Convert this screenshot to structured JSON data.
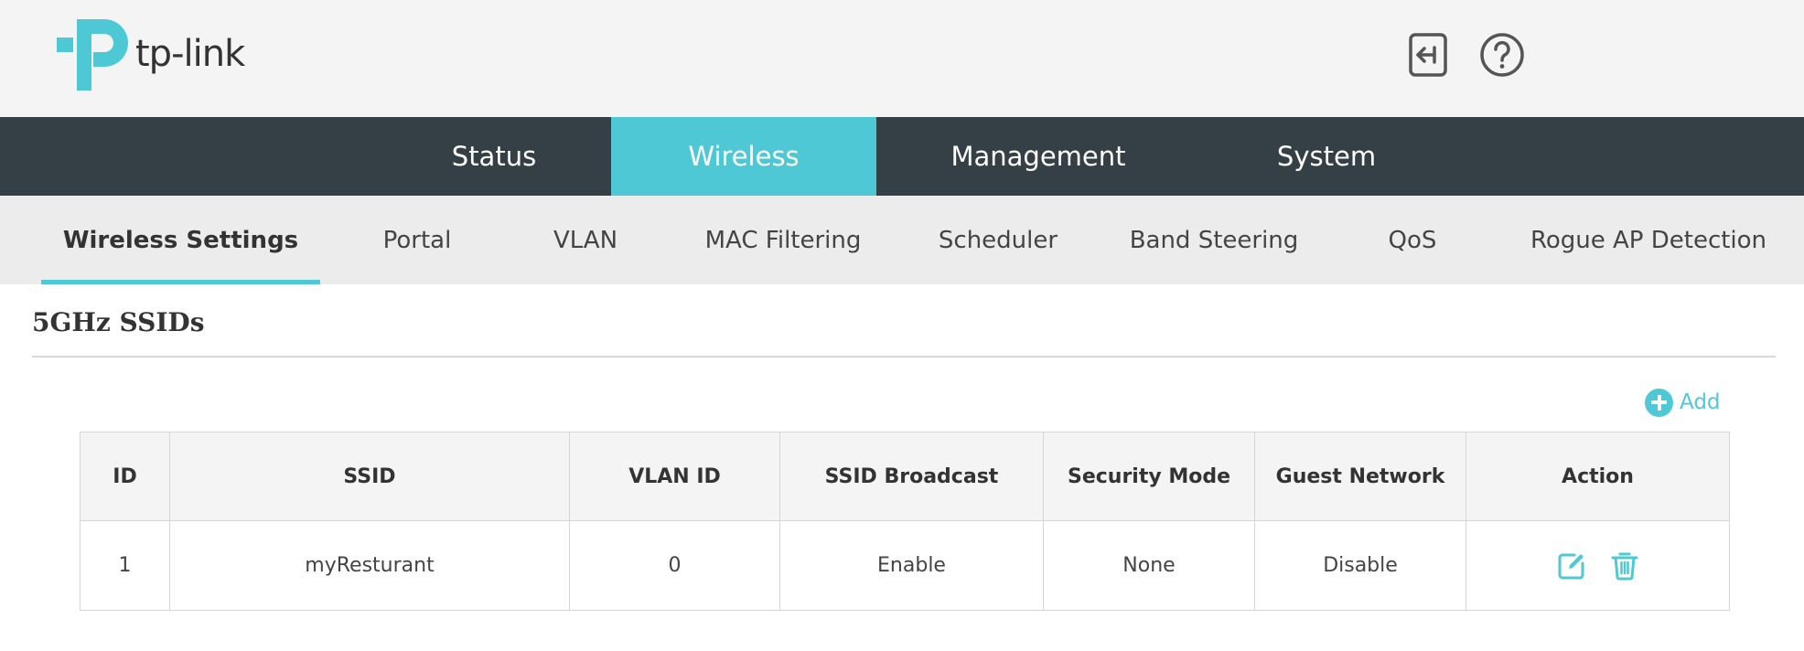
{
  "brand": {
    "name": "tp-link",
    "accent": "#4fc8d6",
    "nav_bg": "#353f46"
  },
  "header": {
    "logout_icon": "logout-icon",
    "help_icon": "help-icon"
  },
  "main_nav": {
    "tabs": [
      {
        "label": "Status"
      },
      {
        "label": "Wireless",
        "active": true
      },
      {
        "label": "Management"
      },
      {
        "label": "System"
      }
    ]
  },
  "sub_nav": {
    "tabs": [
      {
        "label": "Wireless Settings",
        "active": true
      },
      {
        "label": "Portal"
      },
      {
        "label": "VLAN"
      },
      {
        "label": "MAC Filtering"
      },
      {
        "label": "Scheduler"
      },
      {
        "label": "Band Steering"
      },
      {
        "label": "QoS"
      },
      {
        "label": "Rogue AP Detection"
      }
    ]
  },
  "section": {
    "title": "5GHz SSIDs",
    "add_label": "Add"
  },
  "table": {
    "columns": [
      "ID",
      "SSID",
      "VLAN ID",
      "SSID Broadcast",
      "Security Mode",
      "Guest Network",
      "Action"
    ],
    "rows": [
      {
        "id": "1",
        "ssid": "myResturant",
        "vlan_id": "0",
        "ssid_broadcast": "Enable",
        "security_mode": "None",
        "guest_network": "Disable",
        "actions": [
          "edit-icon",
          "delete-icon"
        ]
      }
    ]
  }
}
